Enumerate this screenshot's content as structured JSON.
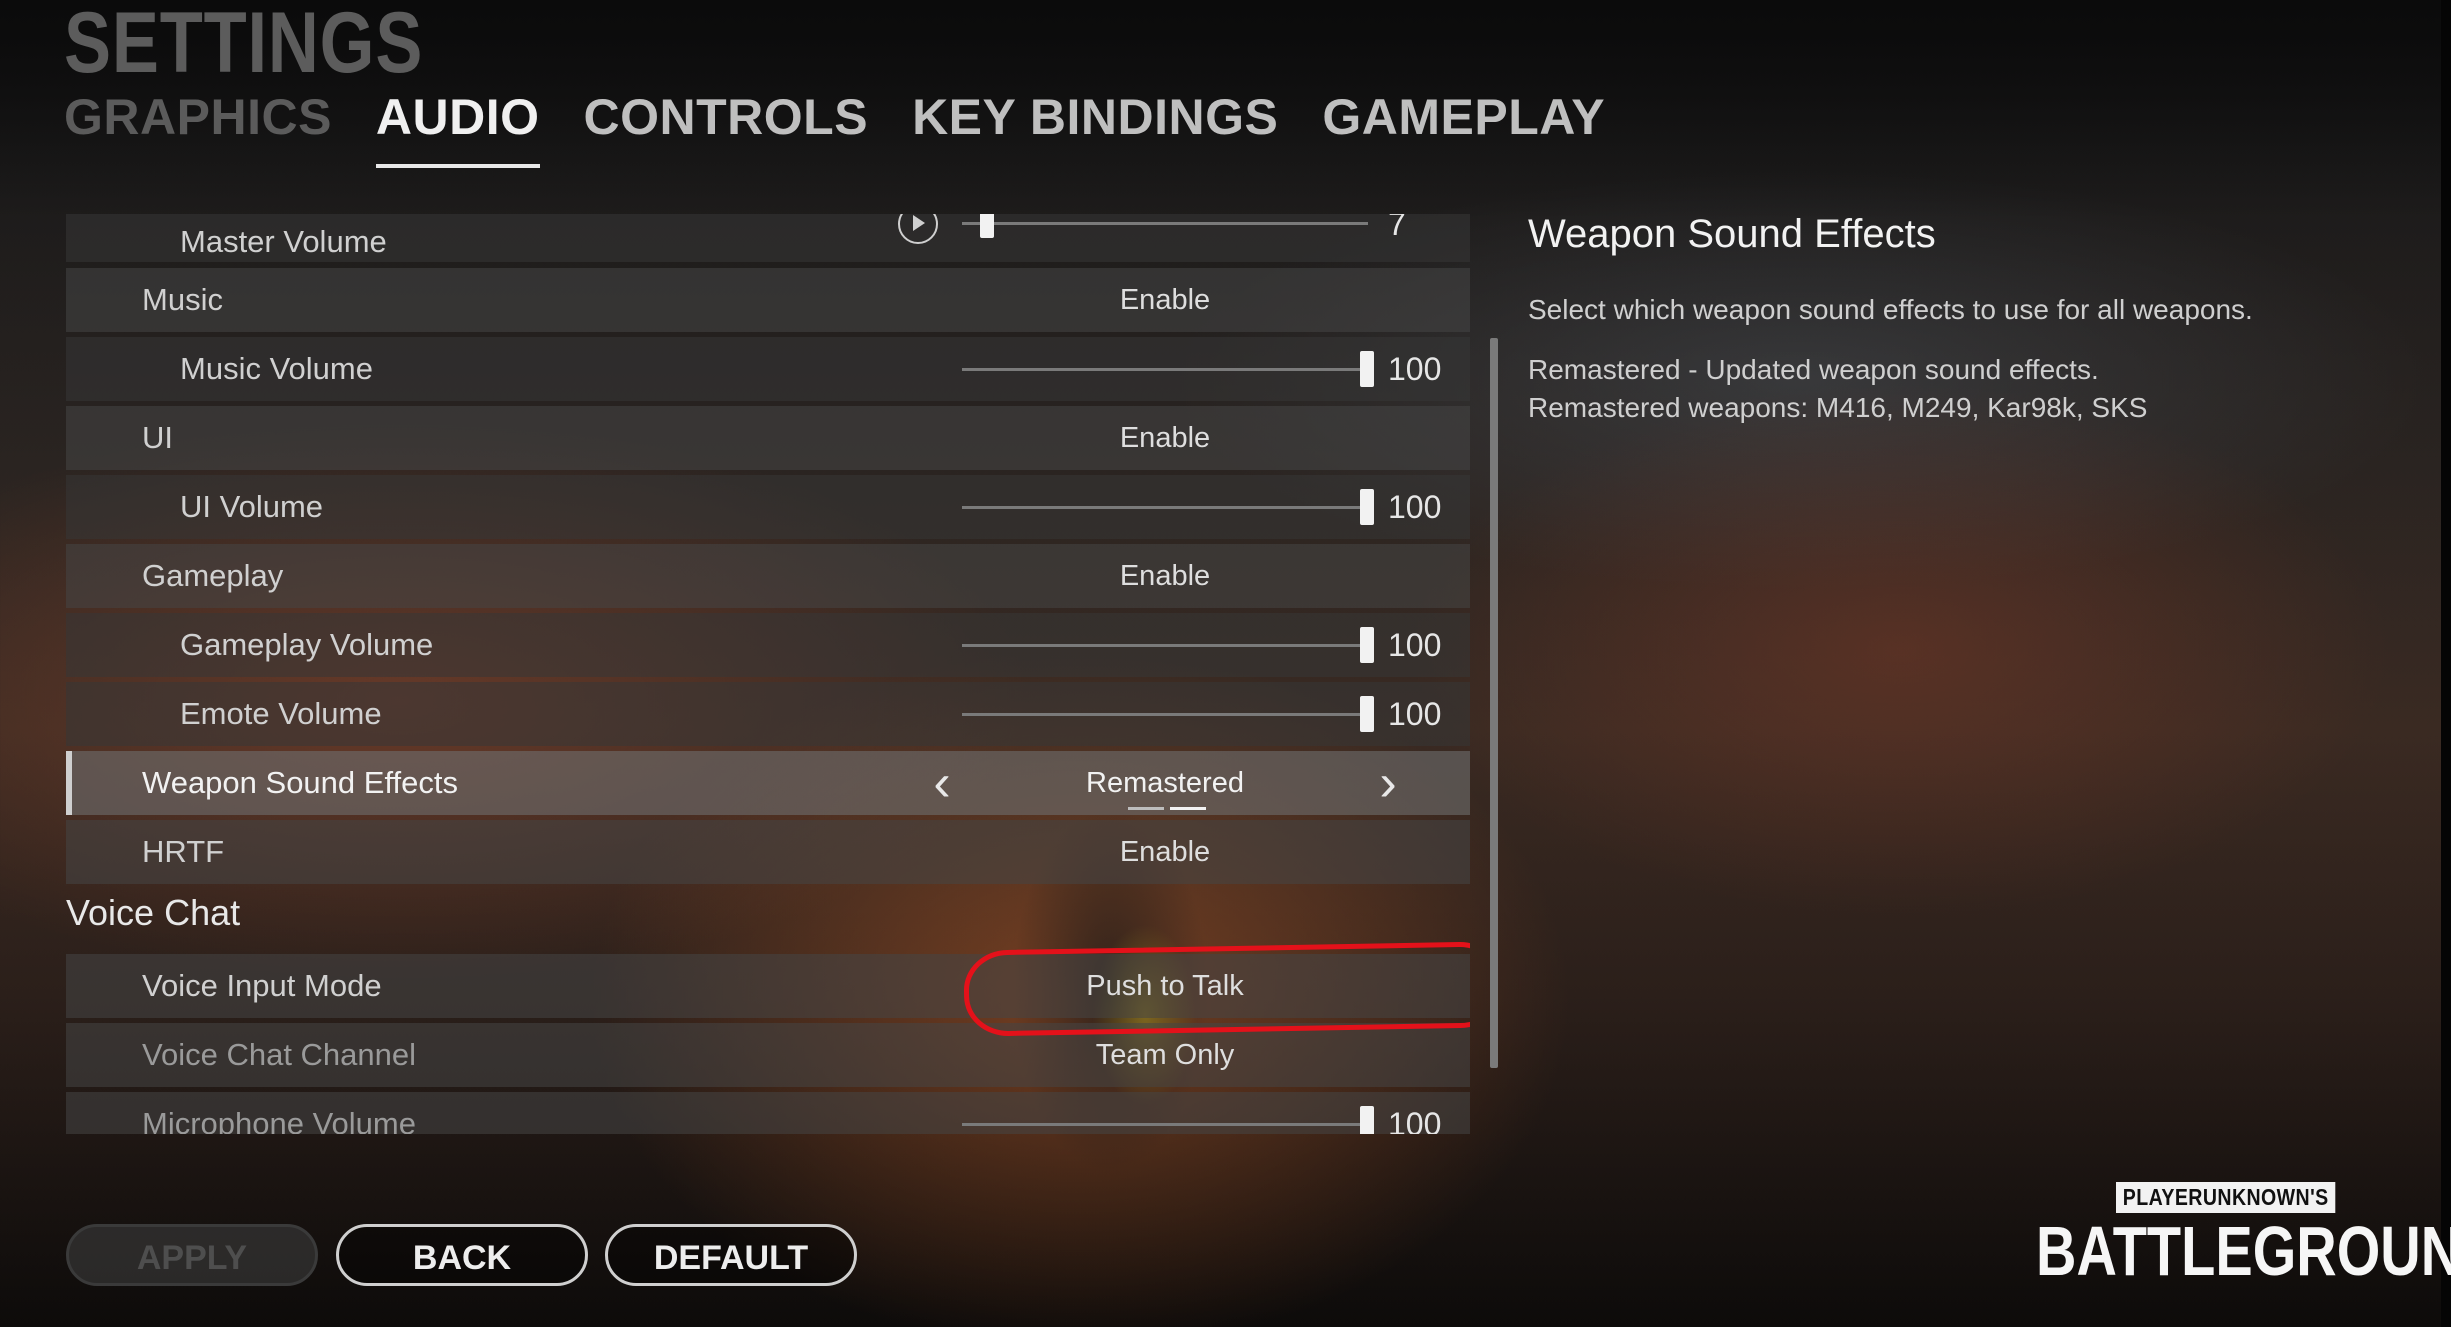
{
  "header": {
    "title": "SETTINGS",
    "tabs": [
      {
        "label": "GRAPHICS"
      },
      {
        "label": "AUDIO"
      },
      {
        "label": "CONTROLS"
      },
      {
        "label": "KEY BINDINGS"
      },
      {
        "label": "GAMEPLAY"
      }
    ],
    "active_tab": "AUDIO"
  },
  "settings": {
    "master_volume": {
      "label": "Master Volume",
      "value": "7"
    },
    "music": {
      "label": "Music",
      "value": "Enable"
    },
    "music_volume": {
      "label": "Music Volume",
      "value": "100"
    },
    "ui": {
      "label": "UI",
      "value": "Enable"
    },
    "ui_volume": {
      "label": "UI Volume",
      "value": "100"
    },
    "gameplay": {
      "label": "Gameplay",
      "value": "Enable"
    },
    "gameplay_volume": {
      "label": "Gameplay Volume",
      "value": "100"
    },
    "emote_volume": {
      "label": "Emote Volume",
      "value": "100"
    },
    "weapon_sound_effects": {
      "label": "Weapon Sound Effects",
      "value": "Remastered"
    },
    "hrtf": {
      "label": "HRTF",
      "value": "Enable"
    },
    "voice_chat_section": "Voice Chat",
    "voice_input_mode": {
      "label": "Voice Input Mode",
      "value": "Push to Talk"
    },
    "voice_chat_channel": {
      "label": "Voice Chat Channel",
      "value": "Team Only"
    },
    "microphone_volume": {
      "label": "Microphone Volume",
      "value": "100"
    }
  },
  "help": {
    "title": "Weapon Sound Effects",
    "description": "Select which weapon sound effects to use for all weapons.",
    "detail_1": "Remastered - Updated weapon sound effects.",
    "detail_2": "Remastered weapons: M416, M249, Kar98k, SKS"
  },
  "buttons": {
    "apply": "APPLY",
    "back": "BACK",
    "default": "DEFAULT"
  },
  "logo": {
    "top": "PLAYERUNKNOWN'S",
    "main": "BATTLEGROUNDS",
    "mark": "®"
  },
  "colors": {
    "highlight_ring": "#e4111a",
    "active_tab": "#f0f0f0",
    "dim_tab": "#5b5b5b"
  }
}
